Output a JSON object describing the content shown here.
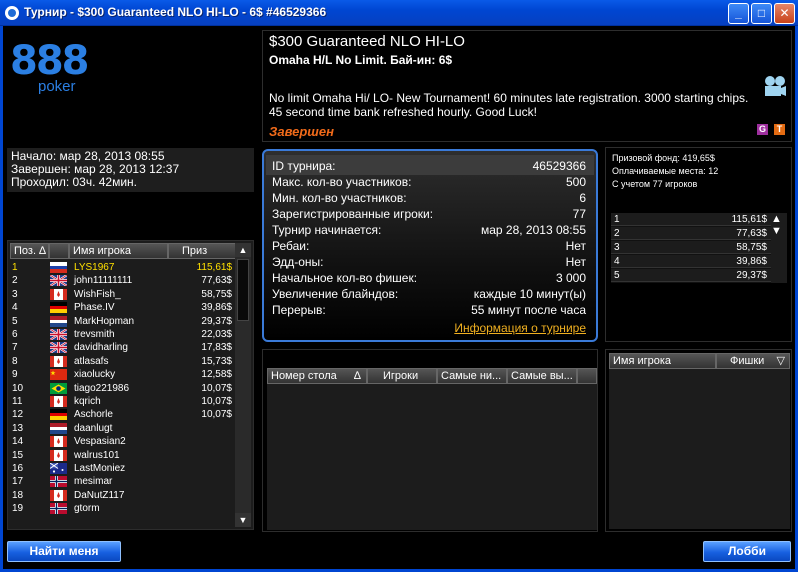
{
  "window": {
    "title": "Турнир - $300 Guaranteed NLO HI-LO - 6$ #46529366"
  },
  "logo": {
    "digits": "888",
    "sub": "poker"
  },
  "times": {
    "start": "Начало: мар 28, 2013 08:55",
    "end": "Завершен: мар 28, 2013 12:37",
    "elapsed": "Проходил: 03ч. 42мин."
  },
  "header": {
    "name": "$300 Guaranteed NLO HI-LO",
    "subtitle": "Omaha H/L No Limit. Бай-ин: 6$",
    "description": "No limit Omaha Hi/ LO- New Tournament!  60 minutes late registration.   3000 starting chips.   45 second time bank refreshed hourly.   Good Luck!",
    "status": "Завершен",
    "badge_g": "G",
    "badge_t": "T"
  },
  "details": {
    "rows": [
      {
        "k": "ID турнира:",
        "v": "46529366"
      },
      {
        "k": "Макс. кол-во участников:",
        "v": "500"
      },
      {
        "k": "Мин. кол-во участников:",
        "v": "6"
      },
      {
        "k": "Зарегистрированные игроки:",
        "v": "77"
      },
      {
        "k": "Турнир начинается:",
        "v": "мар 28, 2013 08:55"
      },
      {
        "k": "Ребаи:",
        "v": "Нет"
      },
      {
        "k": "Эдд-оны:",
        "v": "Нет"
      },
      {
        "k": "Начальное кол-во фишек:",
        "v": "3 000"
      },
      {
        "k": "Увеличение блайндов:",
        "v": "каждые 10 минут(ы)"
      },
      {
        "k": "Перерыв:",
        "v": "55 минут после часа"
      }
    ],
    "link": "Информация о турнире"
  },
  "prize": {
    "fund": "Призовой фонд: 419,65$",
    "paid": "Оплачиваемые места: 12",
    "count": "С учетом 77 игроков",
    "rows": [
      {
        "n": "1",
        "a": "115,61$"
      },
      {
        "n": "2",
        "a": "77,63$"
      },
      {
        "n": "3",
        "a": "58,75$"
      },
      {
        "n": "4",
        "a": "39,86$"
      },
      {
        "n": "5",
        "a": "29,37$"
      }
    ]
  },
  "players": {
    "headers": {
      "pos": "Поз.",
      "name": "Имя игрока",
      "prize": "Приз"
    },
    "rows": [
      {
        "pos": "1",
        "flag": "ru",
        "name": "LYS1967",
        "prize": "115,61$"
      },
      {
        "pos": "2",
        "flag": "uk",
        "name": "john11111111",
        "prize": "77,63$"
      },
      {
        "pos": "3",
        "flag": "ca",
        "name": "WishFish_",
        "prize": "58,75$"
      },
      {
        "pos": "4",
        "flag": "de",
        "name": "Phase.IV",
        "prize": "39,86$"
      },
      {
        "pos": "5",
        "flag": "nl",
        "name": "MarkHopman",
        "prize": "29,37$"
      },
      {
        "pos": "6",
        "flag": "uk",
        "name": "trevsmith",
        "prize": "22,03$"
      },
      {
        "pos": "7",
        "flag": "uk",
        "name": "davidharling",
        "prize": "17,83$"
      },
      {
        "pos": "8",
        "flag": "ca",
        "name": "atlasafs",
        "prize": "15,73$"
      },
      {
        "pos": "9",
        "flag": "cn",
        "name": "xiaolucky",
        "prize": "12,58$"
      },
      {
        "pos": "10",
        "flag": "br",
        "name": "tiago221986",
        "prize": "10,07$"
      },
      {
        "pos": "11",
        "flag": "ca",
        "name": "kqrich",
        "prize": "10,07$"
      },
      {
        "pos": "12",
        "flag": "de",
        "name": "Aschorle",
        "prize": "10,07$"
      },
      {
        "pos": "13",
        "flag": "nl",
        "name": "daanlugt",
        "prize": ""
      },
      {
        "pos": "14",
        "flag": "ca",
        "name": "Vespasian2",
        "prize": ""
      },
      {
        "pos": "15",
        "flag": "ca",
        "name": "walrus101",
        "prize": ""
      },
      {
        "pos": "16",
        "flag": "au",
        "name": "LastMoniez",
        "prize": ""
      },
      {
        "pos": "17",
        "flag": "no",
        "name": "mesimar",
        "prize": ""
      },
      {
        "pos": "18",
        "flag": "ca",
        "name": "DaNutZ117",
        "prize": ""
      },
      {
        "pos": "19",
        "flag": "no",
        "name": "gtorm",
        "prize": ""
      }
    ]
  },
  "tables": {
    "headers": {
      "num": "Номер стола",
      "players": "Игроки",
      "min": "Самые ни...",
      "max": "Самые вы..."
    }
  },
  "table_players": {
    "headers": {
      "name": "Имя игрока",
      "chips": "Фишки"
    }
  },
  "buttons": {
    "find": "Найти меня",
    "lobby": "Лобби"
  },
  "colors": {
    "accent": "#0046d2",
    "status": "#f06a1a",
    "highlight": "#ffe000",
    "link": "#f0b020"
  }
}
